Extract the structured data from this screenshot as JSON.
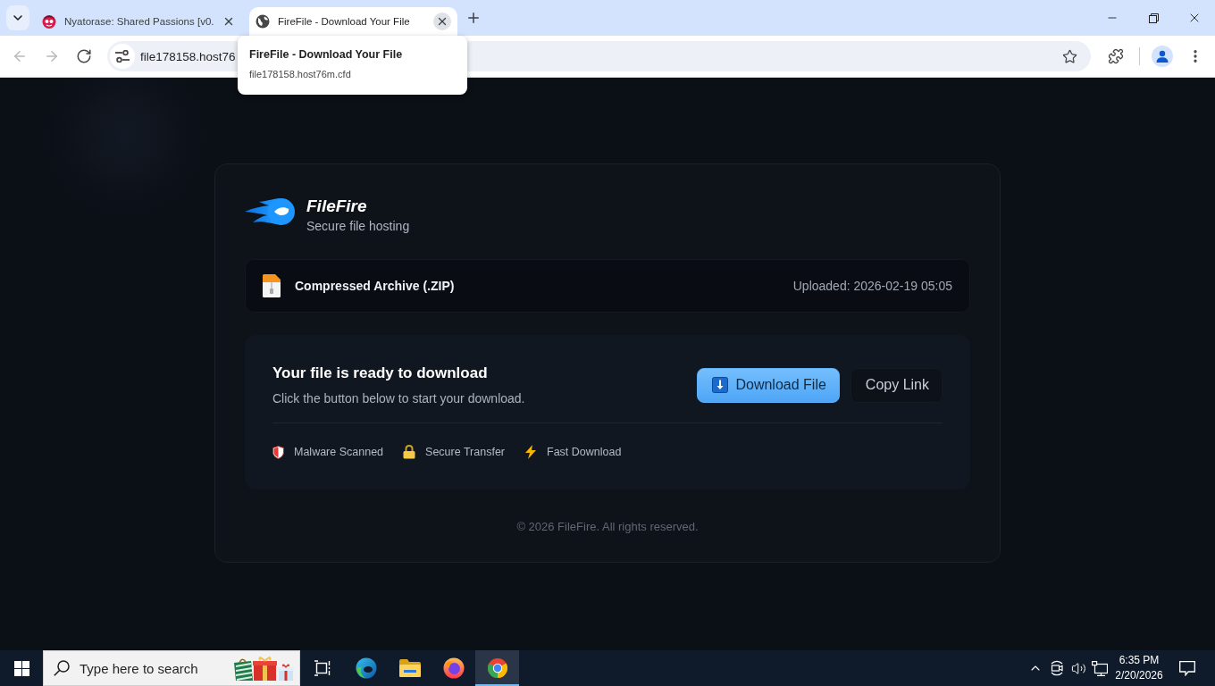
{
  "browser": {
    "tabs": [
      {
        "title": "Nyatorase: Shared Passions [v0.",
        "kind": "avatar",
        "selected": false
      },
      {
        "title": "FireFile - Download Your File",
        "kind": "globe",
        "selected": true
      }
    ],
    "nav_buttons": [
      {
        "kind": "back",
        "disabled": true
      },
      {
        "kind": "forward",
        "disabled": true
      },
      {
        "kind": "reload",
        "disabled": false
      }
    ],
    "address_bar": {
      "value": "file178158.host76"
    },
    "tab_hover_card": {
      "title": "FireFile - Download Your File",
      "url": "file178158.host76m.cfd"
    }
  },
  "page": {
    "brand": {
      "name": "FileFire",
      "tagline": "Secure file hosting"
    },
    "file": {
      "type": "Compressed Archive (.ZIP)",
      "uploaded": "Uploaded: 2026-02-19 05:05"
    },
    "download": {
      "heading": "Your file is ready to download",
      "subtext": "Click the button below to start your download.",
      "buttons": [
        {
          "label": "Download File",
          "kind": "primary"
        },
        {
          "label": "Copy Link",
          "kind": "secondary"
        }
      ],
      "features": [
        {
          "label": "Malware Scanned",
          "kind": "shield"
        },
        {
          "label": "Secure Transfer",
          "kind": "lock"
        },
        {
          "label": "Fast Download",
          "kind": "bolt"
        }
      ]
    },
    "footer": "© 2026 FileFire. All rights reserved."
  },
  "taskbar": {
    "search": {
      "placeholder": "Type here to search"
    },
    "apps": [
      {
        "kind": "task-view",
        "selected": false
      },
      {
        "kind": "edge",
        "selected": false
      },
      {
        "kind": "explorer",
        "selected": false
      },
      {
        "kind": "firefox",
        "selected": false
      },
      {
        "kind": "chrome",
        "selected": true
      }
    ],
    "clock": {
      "time": "6:35 PM",
      "date": "2/20/2026"
    }
  }
}
